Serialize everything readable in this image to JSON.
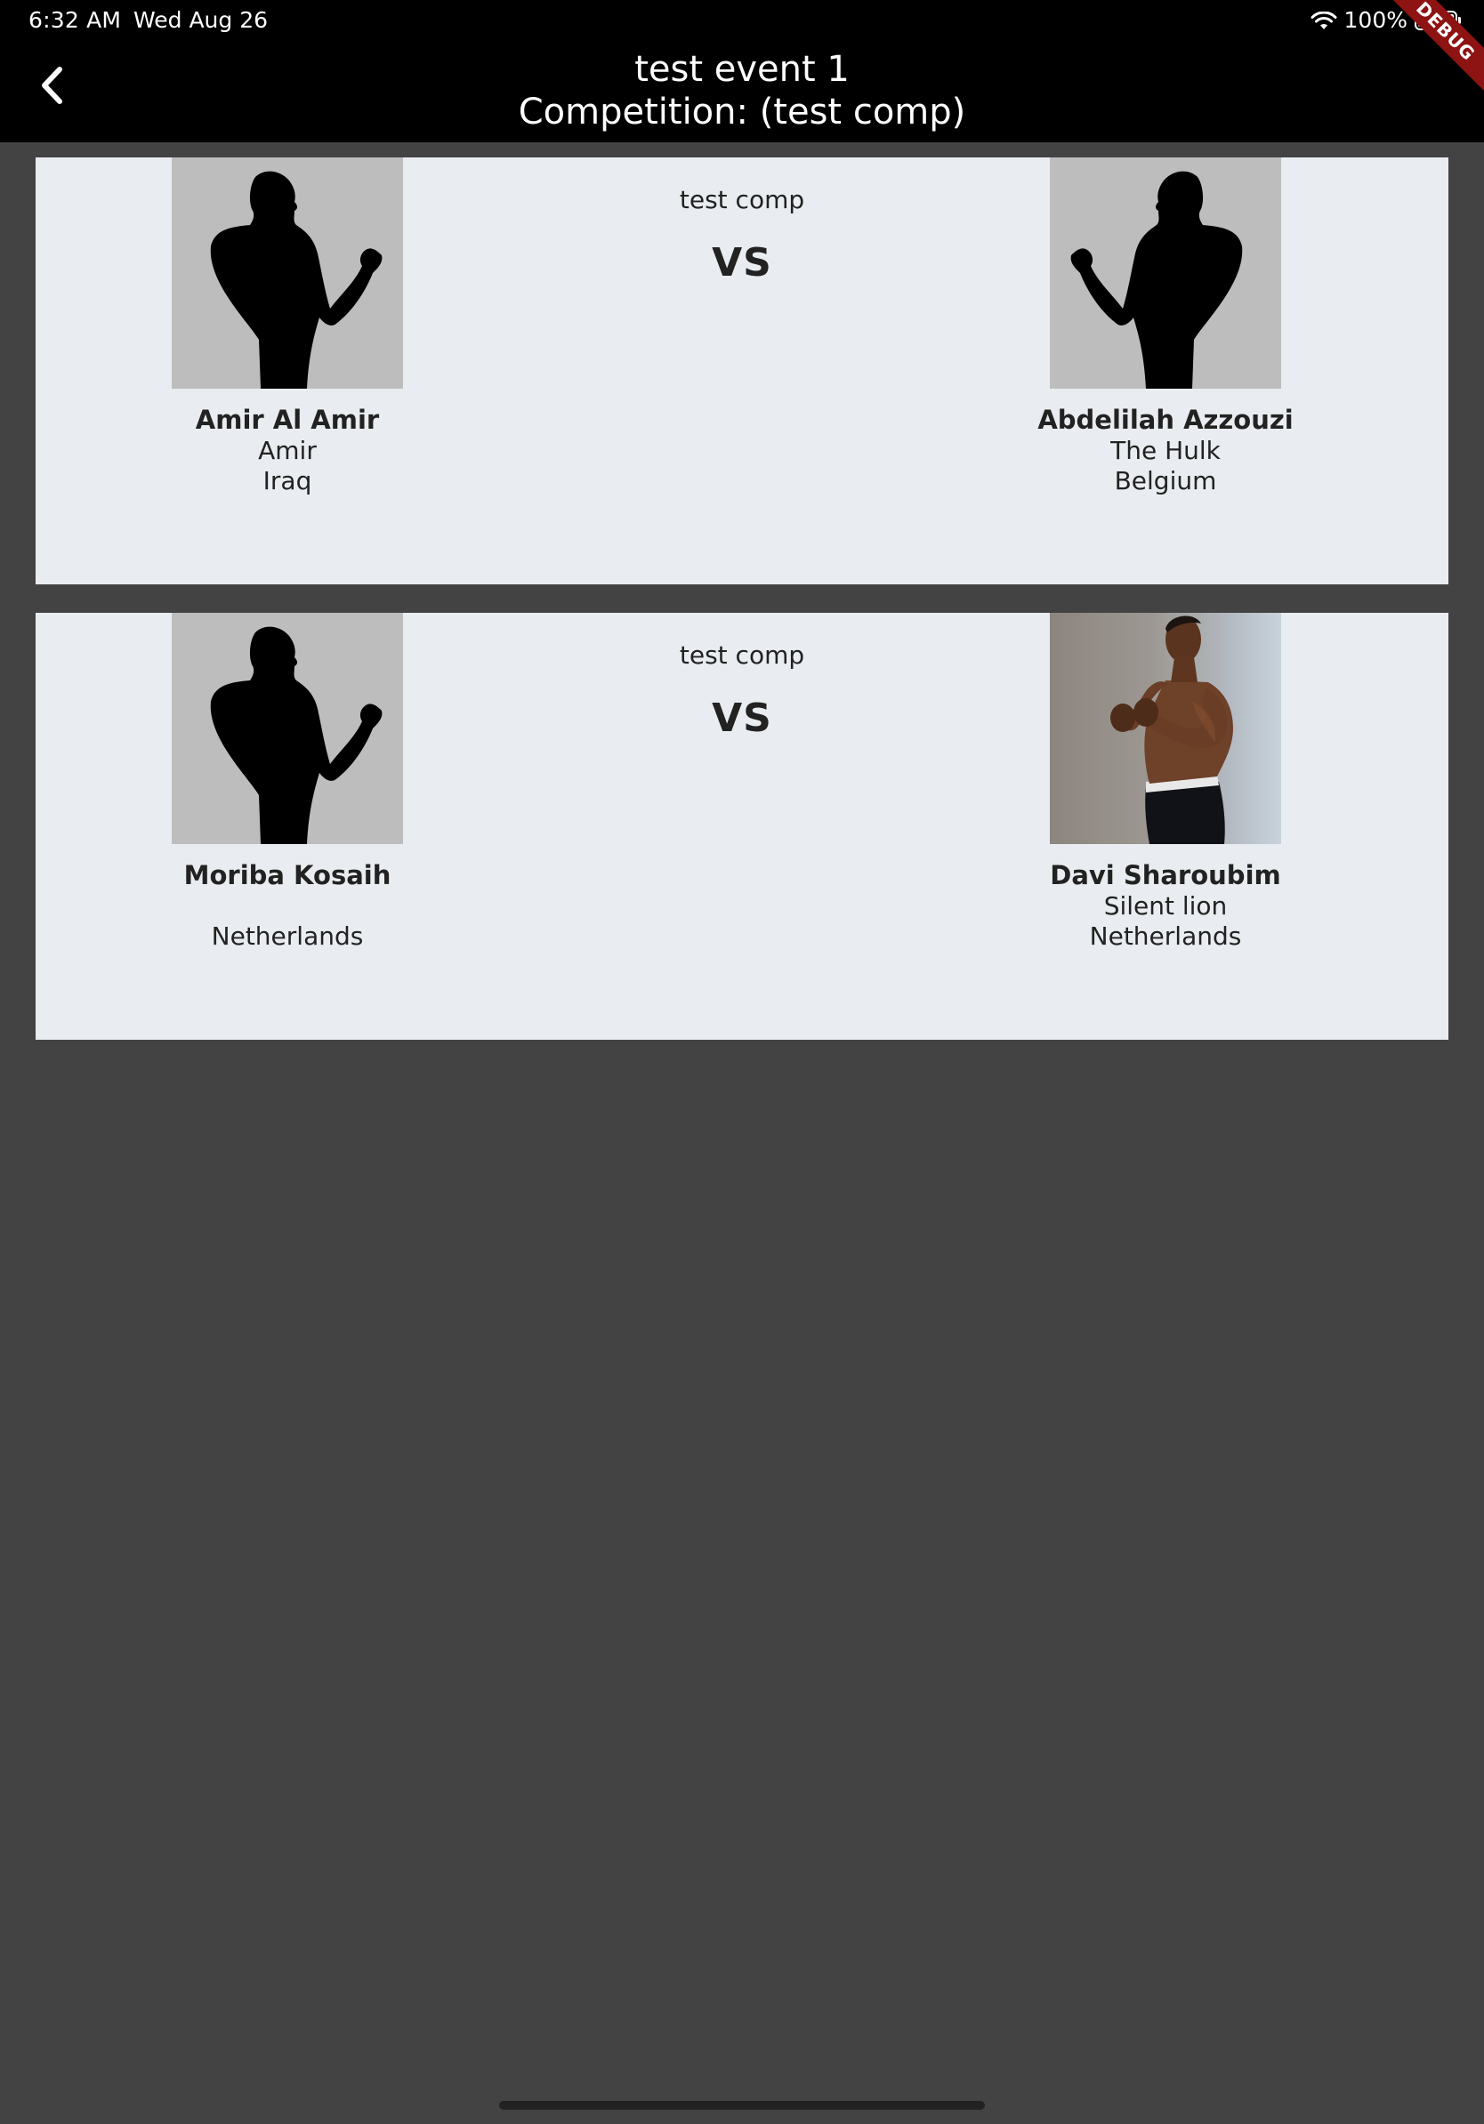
{
  "status_bar": {
    "time": "6:32 AM",
    "date": "Wed Aug 26",
    "battery": "100%"
  },
  "app_bar": {
    "title": "test event 1",
    "subtitle": "Competition: (test comp)",
    "debug_banner": "DEBUG"
  },
  "matches": [
    {
      "competition": "test comp",
      "vs_label": "VS",
      "left": {
        "name": "Amir Al Amir",
        "nickname": "Amir",
        "country": "Iraq",
        "photo": "silhouette"
      },
      "right": {
        "name": "Abdelilah Azzouzi",
        "nickname": "The Hulk",
        "country": "Belgium",
        "photo": "silhouette"
      }
    },
    {
      "competition": "test comp",
      "vs_label": "VS",
      "left": {
        "name": "Moriba Kosaih",
        "nickname": "",
        "country": "Netherlands",
        "photo": "silhouette"
      },
      "right": {
        "name": "Davi Sharoubim",
        "nickname": "Silent lion",
        "country": "Netherlands",
        "photo": "photo"
      }
    }
  ],
  "colors": {
    "background": "#434343",
    "card": "#e9edf1",
    "app_bar": "#000000",
    "debug_ribbon": "#8e1313"
  }
}
